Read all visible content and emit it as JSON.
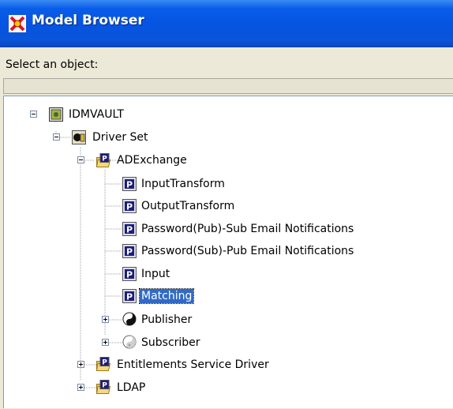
{
  "window": {
    "title": "Model Browser",
    "icon": "model-browser-icon"
  },
  "prompt": "Select an object:",
  "search": {
    "value": ""
  },
  "tree": {
    "root": {
      "label": "IDMVAULT",
      "icon": "vault-icon",
      "state": "expanded"
    },
    "driver_set": {
      "label": "Driver Set",
      "icon": "driver-set-icon",
      "state": "expanded"
    },
    "adexchange": {
      "label": "ADExchange",
      "icon": "driver-folder-icon",
      "state": "expanded"
    },
    "policies": [
      {
        "label": "InputTransform",
        "icon": "policy-icon"
      },
      {
        "label": "OutputTransform",
        "icon": "policy-icon"
      },
      {
        "label": "Password(Pub)-Sub Email Notifications",
        "icon": "policy-icon"
      },
      {
        "label": "Password(Sub)-Pub Email Notifications",
        "icon": "policy-icon"
      },
      {
        "label": "Input",
        "icon": "policy-icon"
      },
      {
        "label": "Matching",
        "icon": "policy-icon",
        "selected": true
      }
    ],
    "publisher": {
      "label": "Publisher",
      "icon": "publisher-icon",
      "state": "collapsed"
    },
    "subscriber": {
      "label": "Subscriber",
      "icon": "subscriber-icon",
      "state": "collapsed"
    },
    "drivers": [
      {
        "label": "Entitlements Service Driver",
        "icon": "driver-folder-icon",
        "state": "collapsed"
      },
      {
        "label": "LDAP",
        "icon": "driver-folder-icon",
        "state": "collapsed"
      }
    ]
  },
  "colors": {
    "titlebar": "#0554e2",
    "selection": "#316ac5",
    "window_bg": "#ece9d8"
  }
}
